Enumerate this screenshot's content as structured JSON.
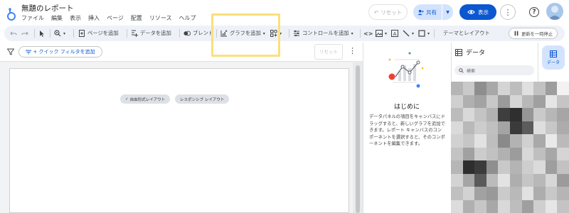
{
  "app": {
    "doc_title": "無題のレポート",
    "menu": [
      "ファイル",
      "編集",
      "表示",
      "挿入",
      "ページ",
      "配置",
      "リソース",
      "ヘルプ"
    ]
  },
  "header": {
    "reset_label": "リセット",
    "share_label": "共有",
    "view_label": "表示"
  },
  "toolbar": {
    "add_page": "ページを追加",
    "add_data": "データを追加",
    "blend": "ブレンド",
    "add_chart": "グラフを追加",
    "add_control": "コントロールを追加",
    "theme_layout": "テーマとレイアウト",
    "pause_updates": "更新を一時停止"
  },
  "filterbar": {
    "quick_filter": "+ クイック フィルタを追加",
    "reset_label": "リセット"
  },
  "canvas": {
    "freeform_chip": "自由形式レイアウト",
    "responsive_chip": "レスポンシブ レイアウト"
  },
  "start_panel": {
    "heading": "はじめに",
    "body": "データパネルの項目をキャンバスにドラッグすると、新しいグラフを追加できます。レポート キャンバスのコンポーネントを選択すると、そのコンポーネントを編集できます。"
  },
  "data_panel": {
    "title": "データ",
    "search_placeholder": "検索"
  },
  "right_rail": {
    "data_tab": "データ"
  },
  "colors": {
    "accent": "#0b57d0",
    "accent_light": "#d3e3fd",
    "highlight": "#f9e07a",
    "toolbar_bg": "#eef2f8"
  },
  "mosaic_shades": [
    "#b5b5b5",
    "#c9c9c9",
    "#8e8e8e",
    "#a8a8a8",
    "#d4d4d4",
    "#bdbdbd",
    "#e0e0e0",
    "#c2c2c2",
    "#9d9d9d",
    "#f2f2f2",
    "#cfcfcf",
    "#b0b0b0",
    "#a3a3a3",
    "#c8c8c8",
    "#9a9a9a",
    "#d6d6d6",
    "#b8b8b8",
    "#a0a0a0",
    "#e5e5e5",
    "#c5c5c5",
    "#bcbcbc",
    "#d9d9d9",
    "#c4c4c4",
    "#b2b2b2",
    "#3e3e3e",
    "#2f2f2f",
    "#969696",
    "#cacaca",
    "#b7b7b7",
    "#a6a6a6",
    "#dadada",
    "#b9b9b9",
    "#cdcdcd",
    "#c0c0c0",
    "#a4a4a4",
    "#3a3a3a",
    "#5c5c5c",
    "#dedede",
    "#c7c7c7",
    "#acacac",
    "#d1d1d1",
    "#c6c6c6",
    "#e2e2e2",
    "#bebebe",
    "#8a8a8a",
    "#b3b3b3",
    "#d0d0d0",
    "#a9a9a9",
    "#e9e9e9",
    "#bababa",
    "#c3c3c3",
    "#a1a1a1",
    "#cccccc",
    "#c1c1c1",
    "#b1b1b1",
    "#9c9c9c",
    "#d8d8d8",
    "#bfbfbf",
    "#a7a7a7",
    "#d5d5d5",
    "#b6b6b6",
    "#2e2e2e",
    "#3b3b3b",
    "#8f8f8f",
    "#c9c9c9",
    "#b4b4b4",
    "#cecece",
    "#dbdbdb",
    "#9e9e9e",
    "#c2c2c2",
    "#d3d3d3",
    "#a5a5a5",
    "#5a5a5a",
    "#bbbbbb",
    "#e3e3e3",
    "#aeaeae",
    "#c5c5c5",
    "#b8b8b8",
    "#d7d7d7",
    "#9b9b9b",
    "#c0c0c0",
    "#d2d2d2",
    "#a2a2a2",
    "#999999",
    "#cbcbcb",
    "#b9b9b9",
    "#e1e1e1",
    "#adadad",
    "#c8c8c8",
    "#b5b5b5",
    "#dcdcdc",
    "#b0b0b0",
    "#c6c6c6",
    "#a8a8a8",
    "#d9d9d9",
    "#bdbdbd",
    "#9f9f9f",
    "#cfcfcf",
    "#e6e6e6",
    "#c4c4c4"
  ]
}
